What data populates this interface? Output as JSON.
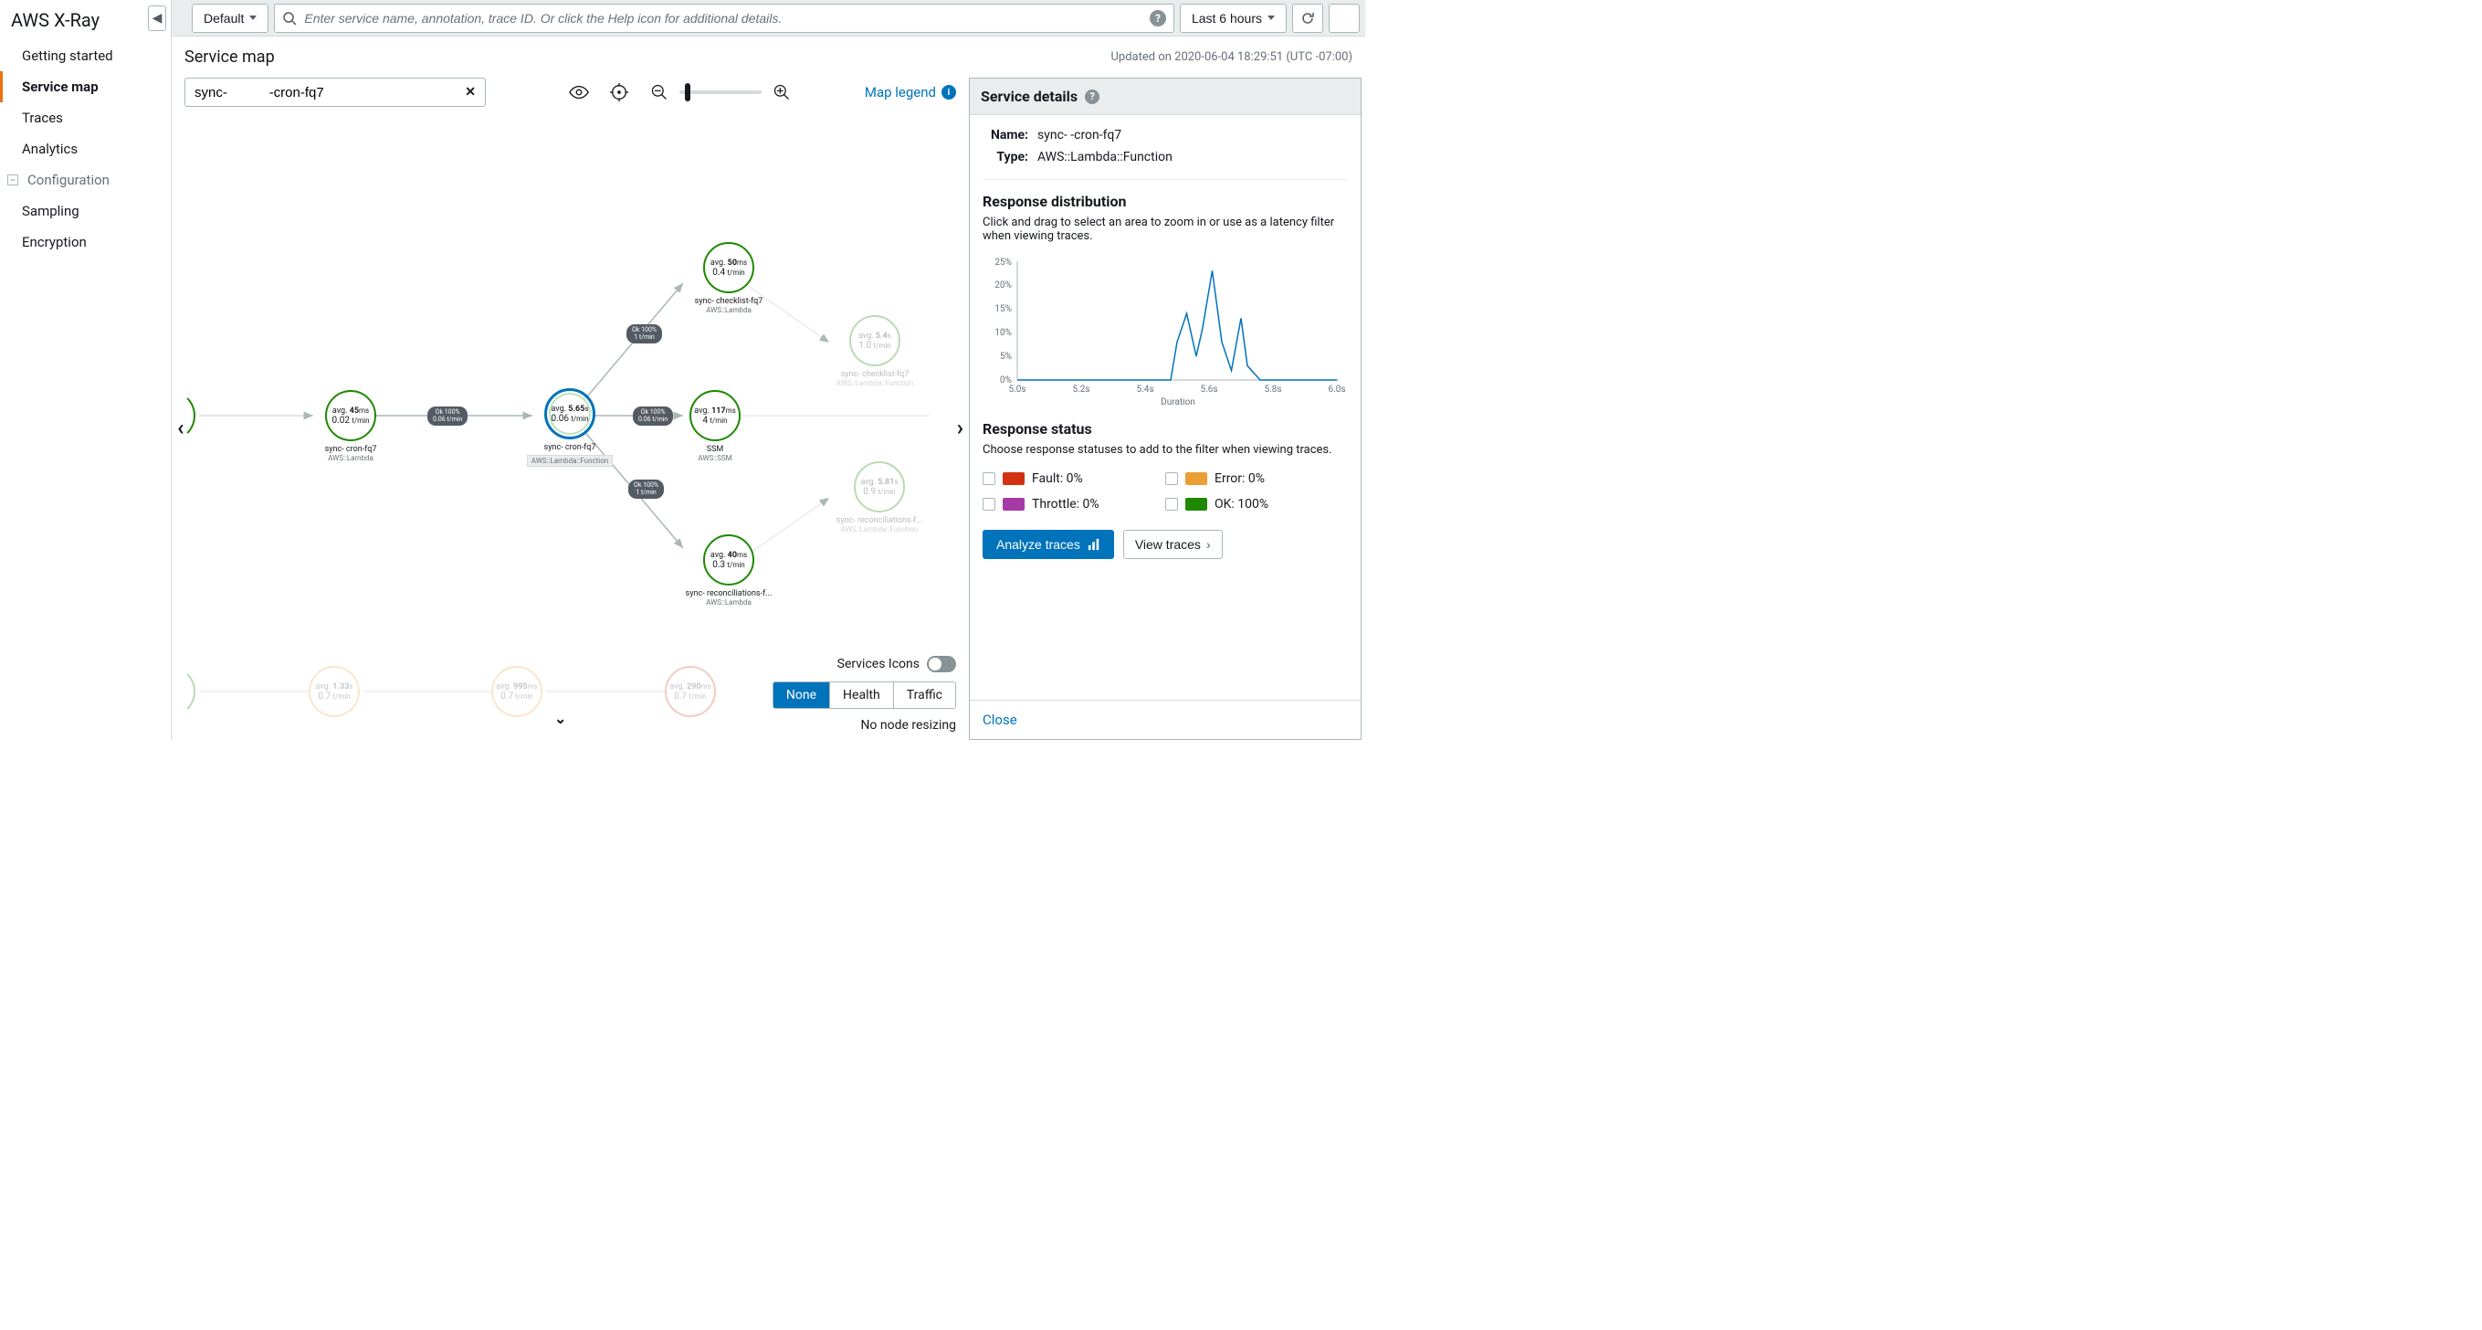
{
  "sidebar": {
    "title": "AWS X-Ray",
    "items": [
      {
        "label": "Getting started"
      },
      {
        "label": "Service map",
        "active": true
      },
      {
        "label": "Traces"
      },
      {
        "label": "Analytics"
      }
    ],
    "group": "Configuration",
    "group_items": [
      {
        "label": "Sampling"
      },
      {
        "label": "Encryption"
      }
    ]
  },
  "topbar": {
    "default_btn": "Default",
    "search_placeholder": "Enter service name, annotation, trace ID. Or click the Help icon for additional details.",
    "timerange": "Last 6 hours"
  },
  "page": {
    "title": "Service map",
    "updated": "Updated on 2020-06-04 18:29:51 (UTC -07:00)"
  },
  "filter": {
    "value": "sync-           -cron-fq7",
    "legend": "Map legend"
  },
  "nodes": {
    "n1": {
      "avg_prefix": "avg.",
      "avg_val": "45",
      "avg_unit": "ms",
      "rate": "0.02",
      "rate_unit": "t/min",
      "name": "sync-           cron-fq7",
      "sub": "AWS::Lambda"
    },
    "n2": {
      "avg_prefix": "avg.",
      "avg_val": "5.65",
      "avg_unit": "s",
      "rate": "0.06",
      "rate_unit": "t/min",
      "name": "sync-          cron-fq7",
      "sub": "AWS::Lambda::Function"
    },
    "n3": {
      "avg_prefix": "avg.",
      "avg_val": "50",
      "avg_unit": "ms",
      "rate": "0.4",
      "rate_unit": "t/min",
      "name": "sync-           checklist-fq7",
      "sub": "AWS::Lambda"
    },
    "n4": {
      "avg_prefix": "avg.",
      "avg_val": "117",
      "avg_unit": "ms",
      "rate": "4",
      "rate_unit": "t/min",
      "name": "SSM",
      "sub": "AWS::SSM"
    },
    "n5": {
      "avg_prefix": "avg.",
      "avg_val": "40",
      "avg_unit": "ms",
      "rate": "0.3",
      "rate_unit": "t/min",
      "name": "sync-           reconciliations-f...",
      "sub": "AWS::Lambda"
    },
    "n6": {
      "avg_prefix": "avg.",
      "avg_val": "5.4",
      "avg_unit": "s",
      "rate": "1.0",
      "rate_unit": "t/min",
      "name": "sync-           checklist-fq7",
      "sub": "AWS::Lambda::Function"
    },
    "n7": {
      "avg_prefix": "avg.",
      "avg_val": "5.81",
      "avg_unit": "s",
      "rate": "0.9",
      "rate_unit": "t/min",
      "name": "sync-           reconciliations-f...",
      "sub": "AWS::Lambda::Function"
    },
    "b1": {
      "avg_prefix": "avg.",
      "avg_val": "1.33",
      "avg_unit": "s",
      "rate": "0.7",
      "rate_unit": "t/min"
    },
    "b2": {
      "avg_prefix": "avg.",
      "avg_val": "995",
      "avg_unit": "ms",
      "rate": "0.7",
      "rate_unit": "t/min"
    },
    "b3": {
      "avg_prefix": "avg.",
      "avg_val": "290",
      "avg_unit": "ms",
      "rate": "0.7",
      "rate_unit": "t/min"
    }
  },
  "edges": {
    "e1": {
      "l1": "Ok 100%",
      "l2": "0.06 t/min"
    },
    "e2": {
      "l1": "Ok 100%",
      "l2": "1 t/min"
    },
    "e3": {
      "l1": "Ok 100%",
      "l2": "0.06 t/min"
    },
    "e4": {
      "l1": "Ok 100%",
      "l2": "1 t/min"
    }
  },
  "bottom": {
    "svc_icons": "Services Icons",
    "segs": [
      "None",
      "Health",
      "Traffic"
    ],
    "no_resize": "No node resizing"
  },
  "details": {
    "header": "Service details",
    "name_label": "Name:",
    "name_val": "sync-              -cron-fq7",
    "type_label": "Type:",
    "type_val": "AWS::Lambda::Function",
    "resp_dist_title": "Response distribution",
    "resp_dist_desc": "Click and drag to select an area to zoom in or use as a latency filter when viewing traces.",
    "resp_status_title": "Response status",
    "resp_status_desc": "Choose response statuses to add to the filter when viewing traces.",
    "statuses": {
      "fault": {
        "label": "Fault: 0%",
        "color": "#d13212"
      },
      "error": {
        "label": "Error: 0%",
        "color": "#eb9e34"
      },
      "throttle": {
        "label": "Throttle: 0%",
        "color": "#a63aa6"
      },
      "ok": {
        "label": "OK: 100%",
        "color": "#1e8900"
      }
    },
    "analyze_btn": "Analyze traces",
    "view_btn": "View traces",
    "close": "Close"
  },
  "chart_data": {
    "type": "line",
    "xlabel": "Duration",
    "ylabel": "",
    "x_ticks": [
      "5.0s",
      "5.2s",
      "5.4s",
      "5.6s",
      "5.8s",
      "6.0s"
    ],
    "y_ticks": [
      "0%",
      "5%",
      "10%",
      "15%",
      "20%",
      "25%"
    ],
    "xlim": [
      5.0,
      6.0
    ],
    "ylim": [
      0,
      25
    ],
    "series": [
      {
        "name": "response",
        "x": [
          5.0,
          5.1,
          5.2,
          5.3,
          5.4,
          5.48,
          5.5,
          5.53,
          5.56,
          5.58,
          5.61,
          5.64,
          5.67,
          5.7,
          5.72,
          5.76,
          5.8,
          5.9,
          6.0
        ],
        "y": [
          0,
          0,
          0,
          0,
          0,
          0,
          8,
          14,
          5,
          11,
          23,
          8,
          2,
          13,
          3,
          0,
          0,
          0,
          0
        ]
      }
    ]
  }
}
